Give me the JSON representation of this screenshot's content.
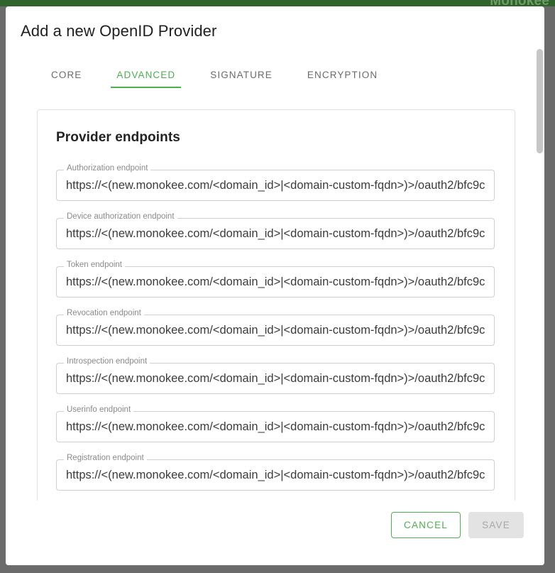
{
  "app": {
    "brand": "Monokee",
    "topbar_color": "#31642c",
    "backdrop_color": "#6b6b6b"
  },
  "dialog": {
    "title": "Add a new OpenID Provider",
    "accent_color": "#4caf50",
    "tabs": [
      {
        "label": "CORE",
        "active": false
      },
      {
        "label": "ADVANCED",
        "active": true
      },
      {
        "label": "SIGNATURE",
        "active": false
      },
      {
        "label": "ENCRYPTION",
        "active": false
      }
    ],
    "card": {
      "heading": "Provider endpoints",
      "fields": [
        {
          "label": "Authorization endpoint",
          "value": "https://<(new.monokee.com/<domain_id>|<domain-custom-fqdn>)>/oauth2/bfc9c",
          "placeholder": ""
        },
        {
          "label": "Device authorization endpoint",
          "value": "https://<(new.monokee.com/<domain_id>|<domain-custom-fqdn>)>/oauth2/bfc9c",
          "placeholder": ""
        },
        {
          "label": "Token endpoint",
          "value": "https://<(new.monokee.com/<domain_id>|<domain-custom-fqdn>)>/oauth2/bfc9c",
          "placeholder": ""
        },
        {
          "label": "Revocation endpoint",
          "value": "https://<(new.monokee.com/<domain_id>|<domain-custom-fqdn>)>/oauth2/bfc9c",
          "placeholder": ""
        },
        {
          "label": "Introspection endpoint",
          "value": "https://<(new.monokee.com/<domain_id>|<domain-custom-fqdn>)>/oauth2/bfc9c",
          "placeholder": ""
        },
        {
          "label": "Userinfo endpoint",
          "value": "https://<(new.monokee.com/<domain_id>|<domain-custom-fqdn>)>/oauth2/bfc9c",
          "placeholder": ""
        },
        {
          "label": "Registration endpoint",
          "value": "https://<(new.monokee.com/<domain_id>|<domain-custom-fqdn>)>/oauth2/bfc9c",
          "placeholder": ""
        }
      ]
    },
    "actions": {
      "cancel_label": "CANCEL",
      "save_label": "SAVE",
      "save_disabled": true
    }
  }
}
